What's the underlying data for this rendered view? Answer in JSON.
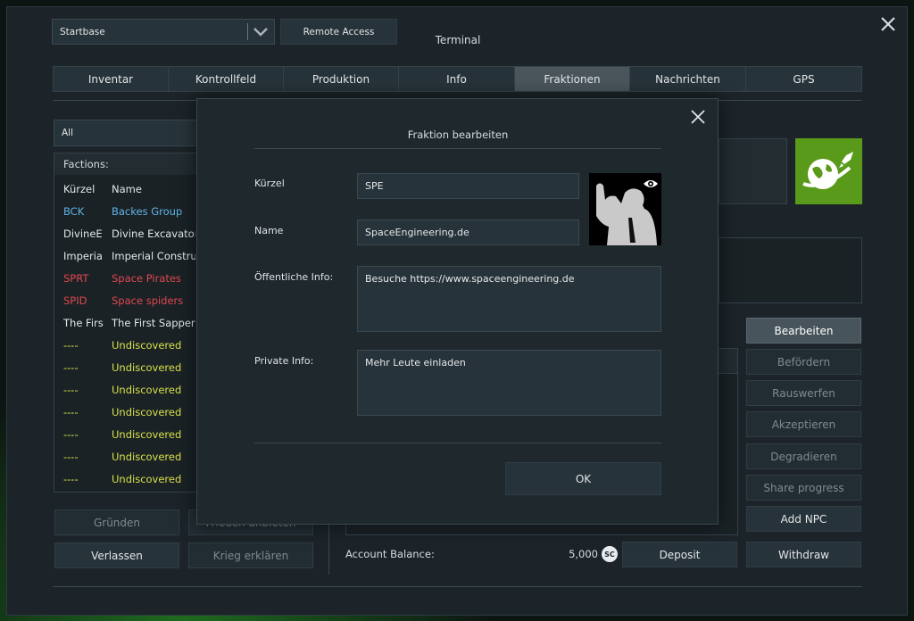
{
  "window": {
    "base_selector": "Startbase",
    "remote_access": "Remote Access",
    "title": "Terminal"
  },
  "tabs": [
    {
      "label": "Inventar"
    },
    {
      "label": "Kontrollfeld"
    },
    {
      "label": "Produktion"
    },
    {
      "label": "Info"
    },
    {
      "label": "Fraktionen",
      "active": true
    },
    {
      "label": "Nachrichten"
    },
    {
      "label": "GPS"
    }
  ],
  "left": {
    "filter": "All",
    "list_title": "Factions:",
    "col_short": "Kürzel",
    "col_name": "Name",
    "rows": [
      {
        "short": "BCK",
        "name": "Backes Group",
        "color": "blue"
      },
      {
        "short": "DivineE",
        "name": "Divine Excavators",
        "color": "white"
      },
      {
        "short": "Imperia",
        "name": "Imperial Construc",
        "color": "white"
      },
      {
        "short": "SPRT",
        "name": "Space Pirates",
        "color": "red"
      },
      {
        "short": "SPID",
        "name": "Space spiders",
        "color": "red"
      },
      {
        "short": "The Firs",
        "name": "The First Sappers",
        "color": "white"
      },
      {
        "short": "----",
        "name": "Undiscovered",
        "color": "yellow"
      },
      {
        "short": "----",
        "name": "Undiscovered",
        "color": "yellow"
      },
      {
        "short": "----",
        "name": "Undiscovered",
        "color": "yellow"
      },
      {
        "short": "----",
        "name": "Undiscovered",
        "color": "yellow"
      },
      {
        "short": "----",
        "name": "Undiscovered",
        "color": "yellow"
      },
      {
        "short": "----",
        "name": "Undiscovered",
        "color": "yellow"
      },
      {
        "short": "----",
        "name": "Undiscovered",
        "color": "yellow"
      }
    ],
    "btn_found": "Gründen",
    "btn_peace": "Frieden anbieten",
    "btn_leave": "Verlassen",
    "btn_war": "Krieg erklären"
  },
  "right": {
    "btn_edit": "Bearbeiten",
    "btn_promote": "Befördern",
    "btn_kick": "Rauswerfen",
    "btn_accept": "Akzeptieren",
    "btn_demote": "Degradieren",
    "btn_share": "Share progress",
    "btn_npc": "Add NPC",
    "btn_withdraw": "Withdraw",
    "btn_deposit": "Deposit",
    "balance_label": "Account Balance:",
    "balance_value": "5,000",
    "currency": "SC"
  },
  "modal": {
    "title": "Fraktion bearbeiten",
    "lbl_short": "Kürzel",
    "val_short": "SPE",
    "lbl_name": "Name",
    "val_name": "SpaceEngineering.de",
    "lbl_public": "Öffentliche Info:",
    "val_public": "Besuche https://www.spaceengineering.de",
    "lbl_private": "Private Info:",
    "val_private": "Mehr Leute einladen",
    "ok": "OK"
  },
  "colors": {
    "blue": "#5fb4e6",
    "red": "#e0474e",
    "yellow": "#d9e04a",
    "white": "#e3e7e9",
    "logo_green": "#5a9a1a"
  }
}
